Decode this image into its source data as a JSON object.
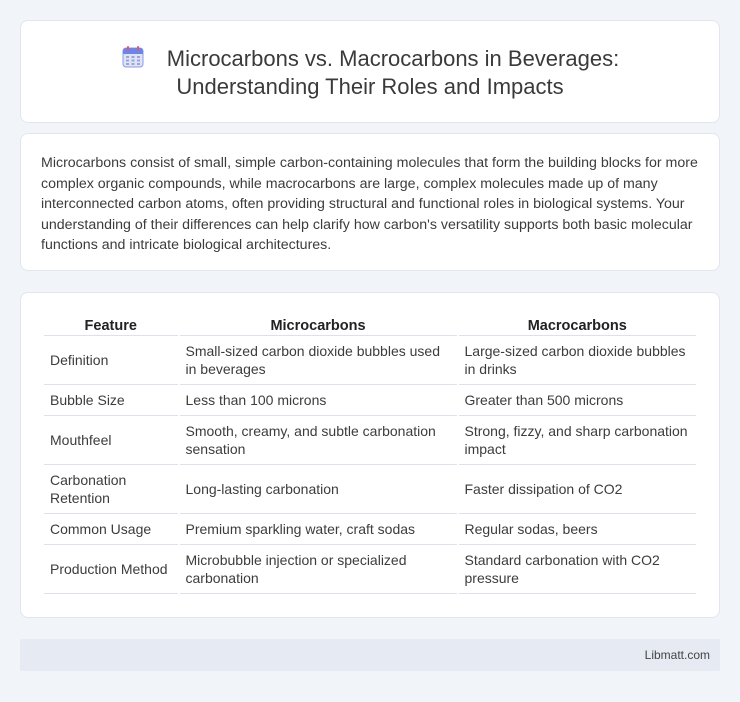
{
  "header": {
    "icon": "calendar-icon",
    "title_line1": "Microcarbons vs. Macrocarbons in Beverages:",
    "title_line2": "Understanding Their Roles and Impacts"
  },
  "intro": {
    "text": "Microcarbons consist of small, simple carbon-containing molecules that form the building blocks for more complex organic compounds, while macrocarbons are large, complex molecules made up of many interconnected carbon atoms, often providing structural and functional roles in biological systems. Your understanding of their differences can help clarify how carbon's versatility supports both basic molecular functions and intricate biological architectures."
  },
  "table": {
    "headers": [
      "Feature",
      "Microcarbons",
      "Macrocarbons"
    ],
    "rows": [
      [
        "Definition",
        "Small-sized carbon dioxide bubbles used in beverages",
        "Large-sized carbon dioxide bubbles in drinks"
      ],
      [
        "Bubble Size",
        "Less than 100 microns",
        "Greater than 500 microns"
      ],
      [
        "Mouthfeel",
        "Smooth, creamy, and subtle carbonation sensation",
        "Strong, fizzy, and sharp carbonation impact"
      ],
      [
        "Carbonation Retention",
        "Long-lasting carbonation",
        "Faster dissipation of CO2"
      ],
      [
        "Common Usage",
        "Premium sparkling water, craft sodas",
        "Regular sodas, beers"
      ],
      [
        "Production Method",
        "Microbubble injection or specialized carbonation",
        "Standard carbonation with CO2 pressure"
      ]
    ]
  },
  "footer": {
    "brand": "Libmatt.com"
  }
}
